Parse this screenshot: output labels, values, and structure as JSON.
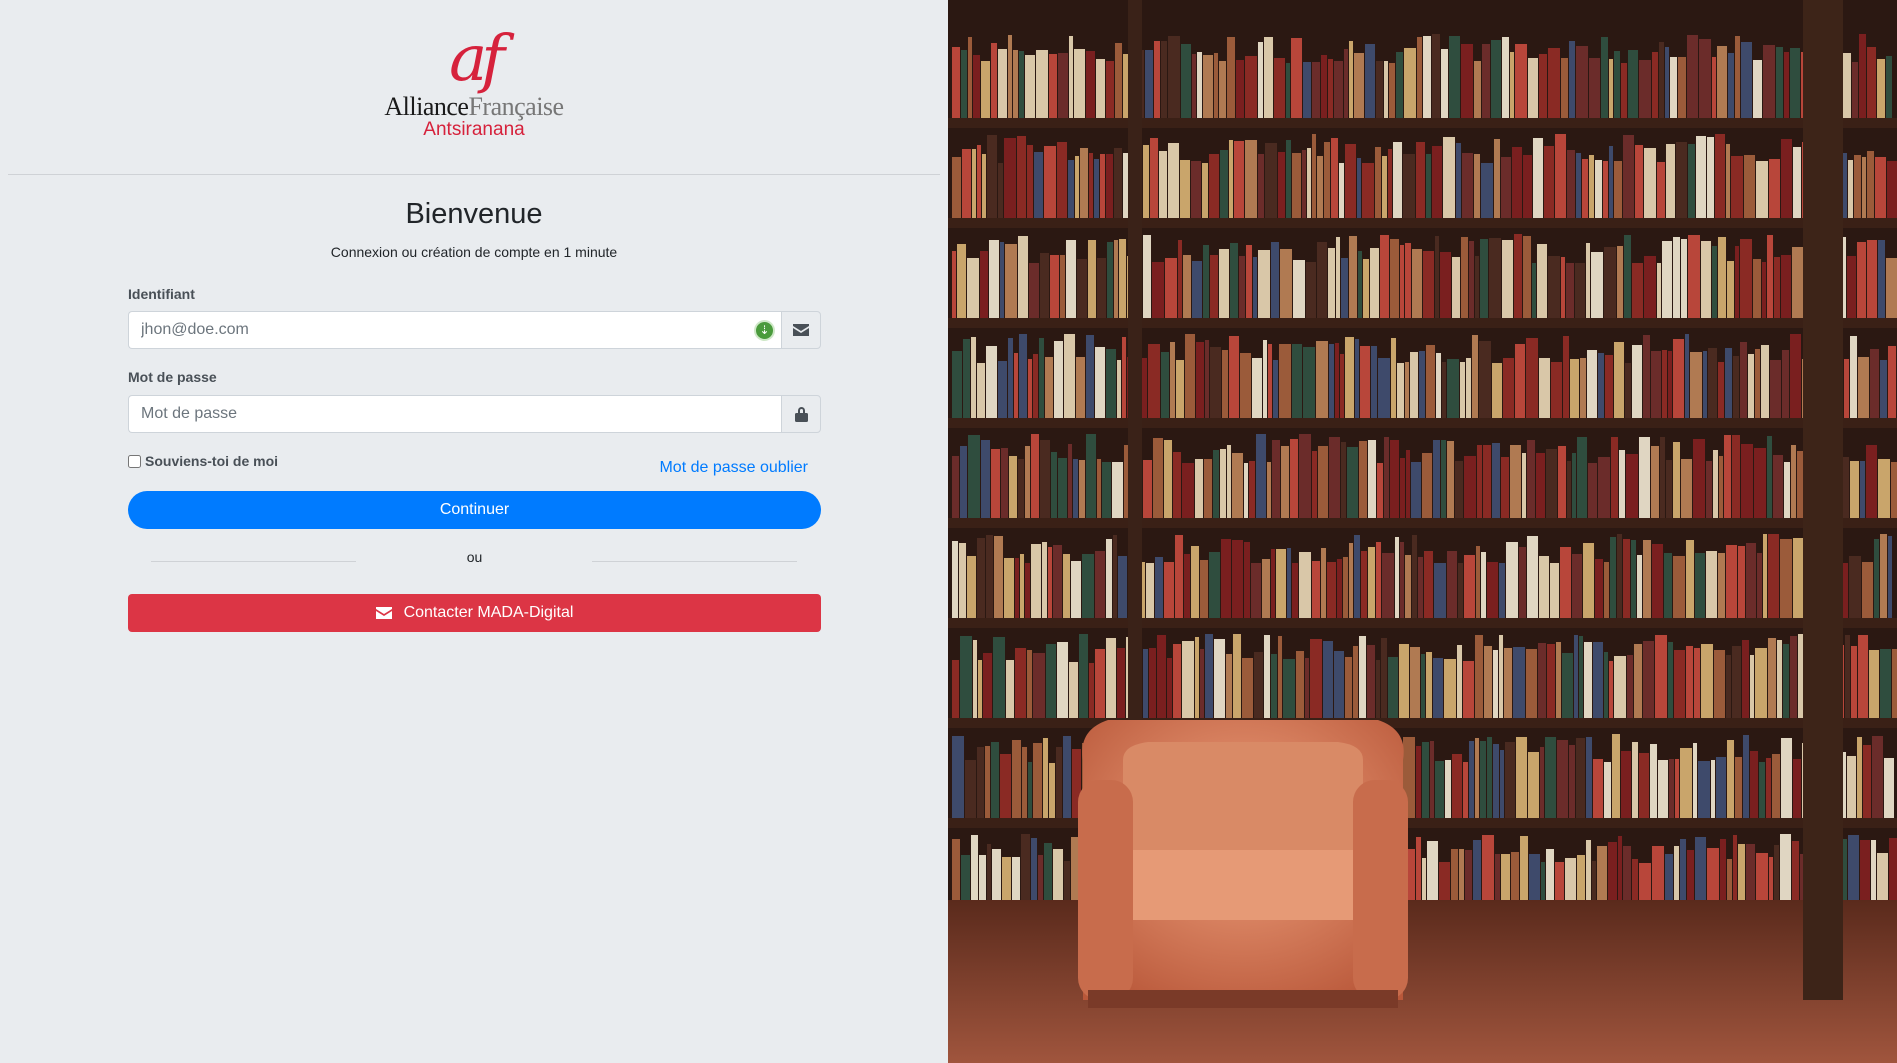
{
  "brand": {
    "logo_mark": "af",
    "name_part1": "Alliance",
    "name_part2": "Française",
    "city": "Antsiranana"
  },
  "header": {
    "title": "Bienvenue",
    "subtitle": "Connexion ou création de compte en 1 minute"
  },
  "form": {
    "identifier_label": "Identifiant",
    "identifier_placeholder": "jhon@doe.com",
    "identifier_icon": "envelope-icon",
    "password_label": "Mot de passe",
    "password_placeholder": "Mot de passe",
    "password_icon": "lock-icon",
    "remember_label": "Souviens-toi de moi",
    "forgot_label": "Mot de passe oublier",
    "submit_label": "Continuer",
    "separator_label": "ou",
    "contact_label": "Contacter MADA-Digital",
    "contact_icon": "envelope-icon"
  },
  "colors": {
    "accent": "#007bff",
    "danger": "#dc3545",
    "brand_red": "#d6223c",
    "panel_bg": "#e9ecef"
  }
}
